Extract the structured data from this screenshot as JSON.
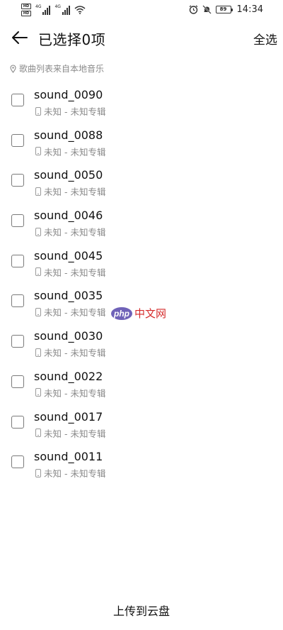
{
  "status_bar": {
    "sim1": "HD",
    "sim2": "HD",
    "sig1_tag": "4G",
    "sig2_tag": "4G",
    "battery": "89",
    "time": "14:34"
  },
  "header": {
    "title": "已选择0项",
    "select_all": "全选"
  },
  "source_hint": "歌曲列表来自本地音乐",
  "songs": [
    {
      "title": "sound_0090",
      "subtitle": "未知 - 未知专辑"
    },
    {
      "title": "sound_0088",
      "subtitle": "未知 - 未知专辑"
    },
    {
      "title": "sound_0050",
      "subtitle": "未知 - 未知专辑"
    },
    {
      "title": "sound_0046",
      "subtitle": "未知 - 未知专辑"
    },
    {
      "title": "sound_0045",
      "subtitle": "未知 - 未知专辑"
    },
    {
      "title": "sound_0035",
      "subtitle": "未知 - 未知专辑"
    },
    {
      "title": "sound_0030",
      "subtitle": "未知 - 未知专辑"
    },
    {
      "title": "sound_0022",
      "subtitle": "未知 - 未知专辑"
    },
    {
      "title": "sound_0017",
      "subtitle": "未知 - 未知专辑"
    },
    {
      "title": "sound_0011",
      "subtitle": "未知 - 未知专辑"
    }
  ],
  "watermark": {
    "php": "php",
    "cn": "中文网"
  },
  "bottom": {
    "upload": "上传到云盘"
  },
  "colors": {
    "text": "#111111",
    "secondary": "#8a8a8a",
    "watermark_purple": "#6f62b8",
    "watermark_red": "#d52a2a"
  },
  "icons": [
    "back-arrow-icon",
    "location-pin-icon",
    "phone-icon",
    "wifi-icon",
    "mute-icon",
    "alarm-icon",
    "battery-icon"
  ]
}
